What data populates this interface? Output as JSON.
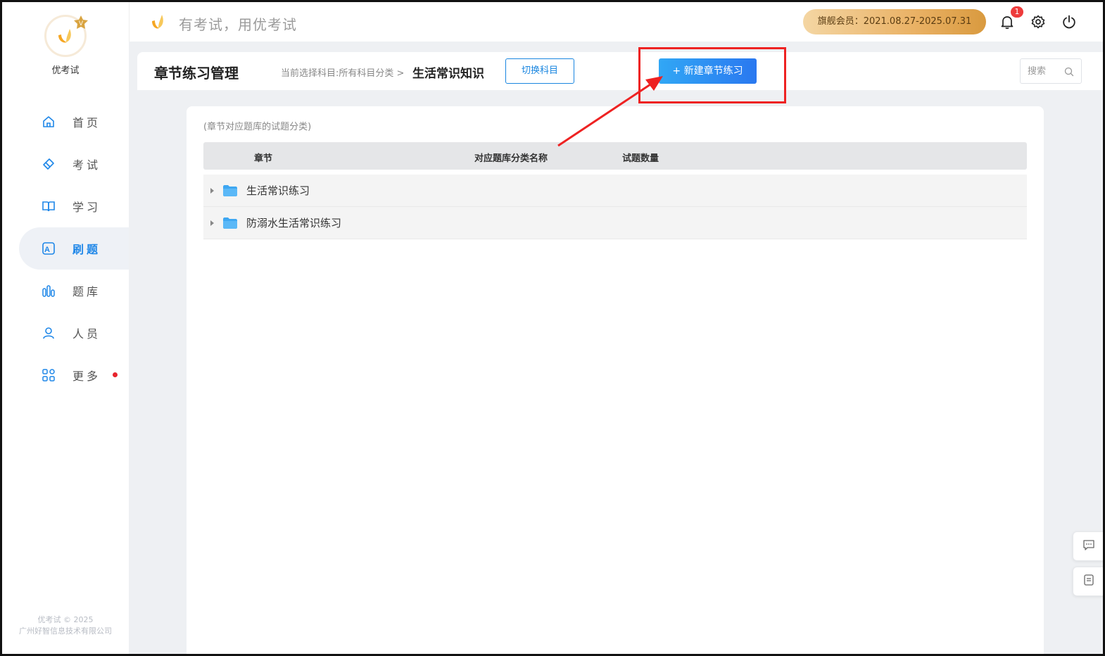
{
  "sidebar": {
    "brand_name": "优考试",
    "logo_badge": "V",
    "items": [
      {
        "label": "首页",
        "icon": "home-icon"
      },
      {
        "label": "考试",
        "icon": "eraser-icon"
      },
      {
        "label": "学习",
        "icon": "book-icon"
      },
      {
        "label": "刷题",
        "icon": "quiz-a-icon",
        "active": true
      },
      {
        "label": "题库",
        "icon": "bars-icon"
      },
      {
        "label": "人员",
        "icon": "user-icon"
      },
      {
        "label": "更多",
        "icon": "apps-icon",
        "dot": true
      }
    ],
    "copyright_line1": "优考试 © 2025",
    "copyright_line2": "广州好智信息技术有限公司"
  },
  "header": {
    "slogan": "有考试，用优考试",
    "membership": "旗舰会员：2021.08.27-2025.07.31",
    "notification_count": "1",
    "icons": [
      "bell-icon",
      "gear-icon",
      "power-icon"
    ]
  },
  "page": {
    "title": "章节练习管理",
    "breadcrumb_prefix": "当前选择科目:所有科目分类 >",
    "breadcrumb_current": "生活常识知识",
    "switch_button": "切换科目",
    "new_button": "+ 新建章节练习",
    "search_placeholder": "搜索"
  },
  "content": {
    "hint": "(章节对应题库的试题分类)",
    "columns": [
      "章节",
      "对应题库分类名称",
      "试题数量"
    ],
    "rows": [
      {
        "name": "生活常识练习"
      },
      {
        "name": "防溺水生活常识练习"
      }
    ]
  },
  "colors": {
    "accent": "#1a86e0",
    "primary_button": "#2a78f0",
    "annotation": "#ee2222",
    "member_gold": "#eab266"
  }
}
